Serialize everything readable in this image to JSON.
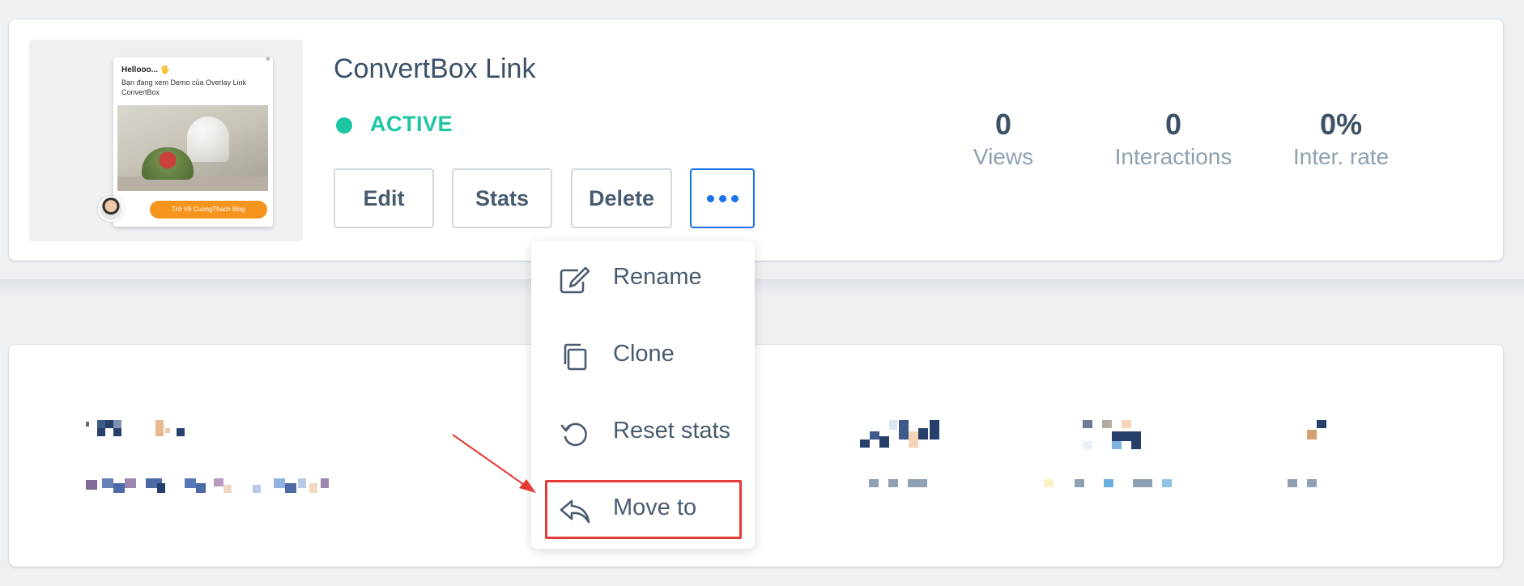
{
  "campaign": {
    "title": "ConvertBox Link",
    "status": "ACTIVE",
    "status_color": "#1cc6a2",
    "preview": {
      "popup_title": "Hellooo... 🖐",
      "popup_text": "Bạn đang xem Demo của Overlay Link ConvertBox",
      "popup_button": "Trở Về CuongThach Blog",
      "close_label": "×"
    }
  },
  "actions": {
    "edit": "Edit",
    "stats": "Stats",
    "delete": "Delete",
    "more_icon": "more-horizontal-icon"
  },
  "stats": [
    {
      "value": "0",
      "label": "Views"
    },
    {
      "value": "0",
      "label": "Interactions"
    },
    {
      "value": "0%",
      "label": "Inter. rate"
    }
  ],
  "menu": {
    "items": [
      {
        "label": "Rename",
        "icon": "edit-icon"
      },
      {
        "label": "Clone",
        "icon": "clone-icon"
      },
      {
        "label": "Reset stats",
        "icon": "reset-icon"
      },
      {
        "label": "Move to",
        "icon": "reply-icon"
      }
    ]
  },
  "colors": {
    "accent": "#1a73e8",
    "annotation": "#e53935"
  }
}
